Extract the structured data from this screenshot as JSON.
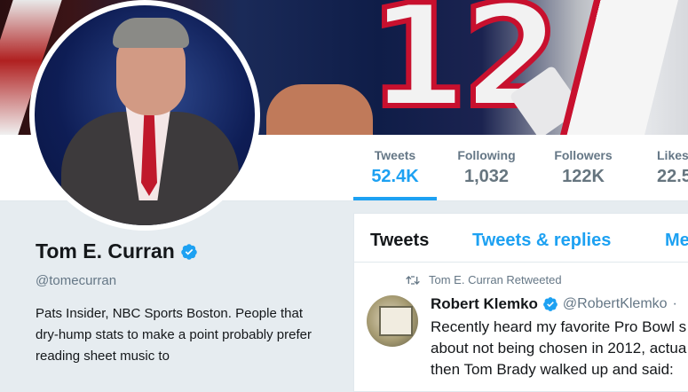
{
  "profile": {
    "name": "Tom E. Curran",
    "handle": "@tomecurran",
    "bio": "Pats Insider, NBC Sports Boston. People that dry-hump stats to make a point probably prefer reading sheet music to"
  },
  "stats": {
    "tweets": {
      "label": "Tweets",
      "value": "52.4K"
    },
    "following": {
      "label": "Following",
      "value": "1,032"
    },
    "followers": {
      "label": "Followers",
      "value": "122K"
    },
    "likes": {
      "label": "Likes",
      "value": "22.5"
    }
  },
  "timeline": {
    "tabs": [
      "Tweets",
      "Tweets & replies",
      "Me"
    ],
    "active_tab": "Tweets",
    "tweet": {
      "retweet_note": "Tom E. Curran Retweeted",
      "author_name": "Robert Klemko",
      "author_handle": "@RobertKlemko",
      "dot": "·",
      "text_lines": [
        "Recently heard my favorite Pro Bowl s",
        "about not being chosen in 2012, actua",
        "then Tom Brady walked up and said:"
      ]
    }
  },
  "banner": {
    "jersey_number": "12"
  },
  "colors": {
    "accent": "#1da1f2",
    "muted": "#657786",
    "background": "#e6ecf0"
  },
  "icons": {
    "verified": "verified-badge-icon",
    "retweet": "retweet-icon"
  }
}
